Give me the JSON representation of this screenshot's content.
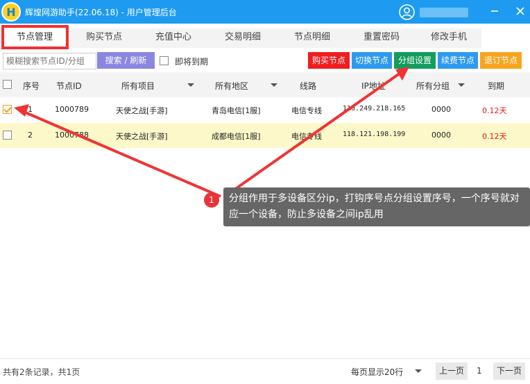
{
  "titlebar": {
    "logo_letter": "H",
    "title": "辉煌网游助手(22.06.18) - 用户管理后台"
  },
  "tabs": [
    {
      "label": "节点管理",
      "active": true
    },
    {
      "label": "购买节点"
    },
    {
      "label": "充值中心"
    },
    {
      "label": "交易明细"
    },
    {
      "label": "节点明细"
    },
    {
      "label": "重置密码"
    },
    {
      "label": "修改手机"
    }
  ],
  "toolbar": {
    "search_placeholder": "模糊搜索节点ID/分组",
    "search_button": "搜索 / 刷新",
    "expire_label": "即将到期",
    "buttons": {
      "buy": "购买节点",
      "switch": "切换节点",
      "group": "分组设置",
      "renew": "续费节点",
      "cancel": "退订节点"
    }
  },
  "table": {
    "headers": {
      "seq": "序号",
      "node_id": "节点ID",
      "project": "所有项目",
      "region": "所有地区",
      "line": "线路",
      "ip": "IP地址",
      "group": "所有分组",
      "expire": "到期"
    },
    "rows": [
      {
        "checked": true,
        "seq": "1",
        "node_id": "1000789",
        "project": "天使之战[手游]",
        "region": "青岛电信[1服]",
        "line": "电信专线",
        "ip": "110.249.218.165",
        "group": "0000",
        "expire": "0.12天"
      },
      {
        "checked": false,
        "seq": "2",
        "node_id": "1000788",
        "project": "天使之战[手游]",
        "region": "成都电信[1服]",
        "line": "电信专线",
        "ip": "118.121.198.199",
        "group": "0000",
        "expire": "0.12天"
      }
    ]
  },
  "tooltip": {
    "number": "1",
    "text": "分组作用于多设备区分ip，打钩序号点分组设置序号，一个序号就对应一个设备，防止多设备之间ip乱用"
  },
  "footer": {
    "record_count": "共有2条记录，共1页",
    "per_page": "每页显示20行",
    "prev": "上一页",
    "page": "1",
    "next": "下一页"
  },
  "colors": {
    "titlebar": "#1e9bf0",
    "annotation": "#f23030",
    "buy": "#ef1d1d",
    "group": "#129d5e",
    "cancel": "#f7a51d",
    "highlight_row": "#fdf8c9"
  }
}
